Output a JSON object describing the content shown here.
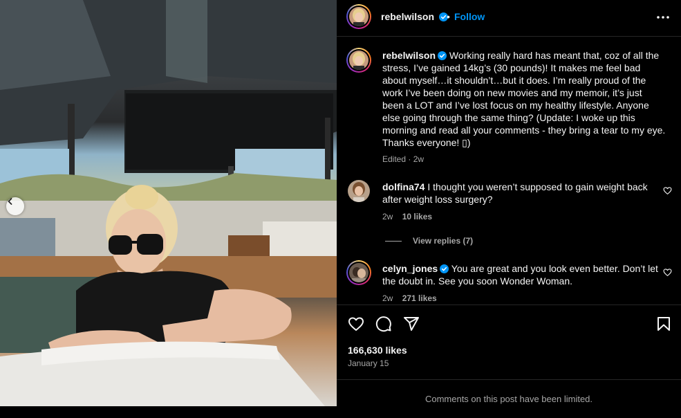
{
  "post": {
    "username": "rebelwilson",
    "follow_label": "Follow",
    "dot": "•",
    "caption": {
      "username": "rebelwilson",
      "text": "Working really hard has meant that, coz of all the stress, I’ve gained 14kg’s (30 pounds)! It makes me feel bad about myself…it shouldn’t…but it does. I’m really proud of the work I’ve been doing on new movies and my memoir, it’s just been a LOT and I’ve lost focus on my healthy lifestyle. Anyone else going through the same thing? (Update: I woke up this morning and read all your comments - they bring a tear to my eye. Thanks everyone! ▯)",
      "meta": "Edited · 2w"
    },
    "comments": [
      {
        "username": "dolfina74",
        "text": "I thought you weren’t supposed to gain weight back after weight loss surgery?",
        "time": "2w",
        "likes": "10 likes",
        "view_replies": "View replies (7)"
      },
      {
        "username": "celyn_jones",
        "text": "You are great and you look even better. Don’t let the doubt in. See you soon Wonder Woman.",
        "time": "2w",
        "likes": "271 likes"
      }
    ],
    "likes_count": "166,630 likes",
    "date": "January 15",
    "comments_limited": "Comments on this post have been limited."
  },
  "icons": {
    "verified": "verified-badge-icon",
    "more": "more-options-icon",
    "like": "heart-icon",
    "comment": "comment-icon",
    "share": "share-icon",
    "save": "bookmark-icon",
    "prev": "chevron-left-icon"
  },
  "colors": {
    "accent": "#0095f6",
    "text": "#f5f5f5",
    "muted": "#a8a8a8",
    "divider": "#262626",
    "background": "#000000"
  }
}
